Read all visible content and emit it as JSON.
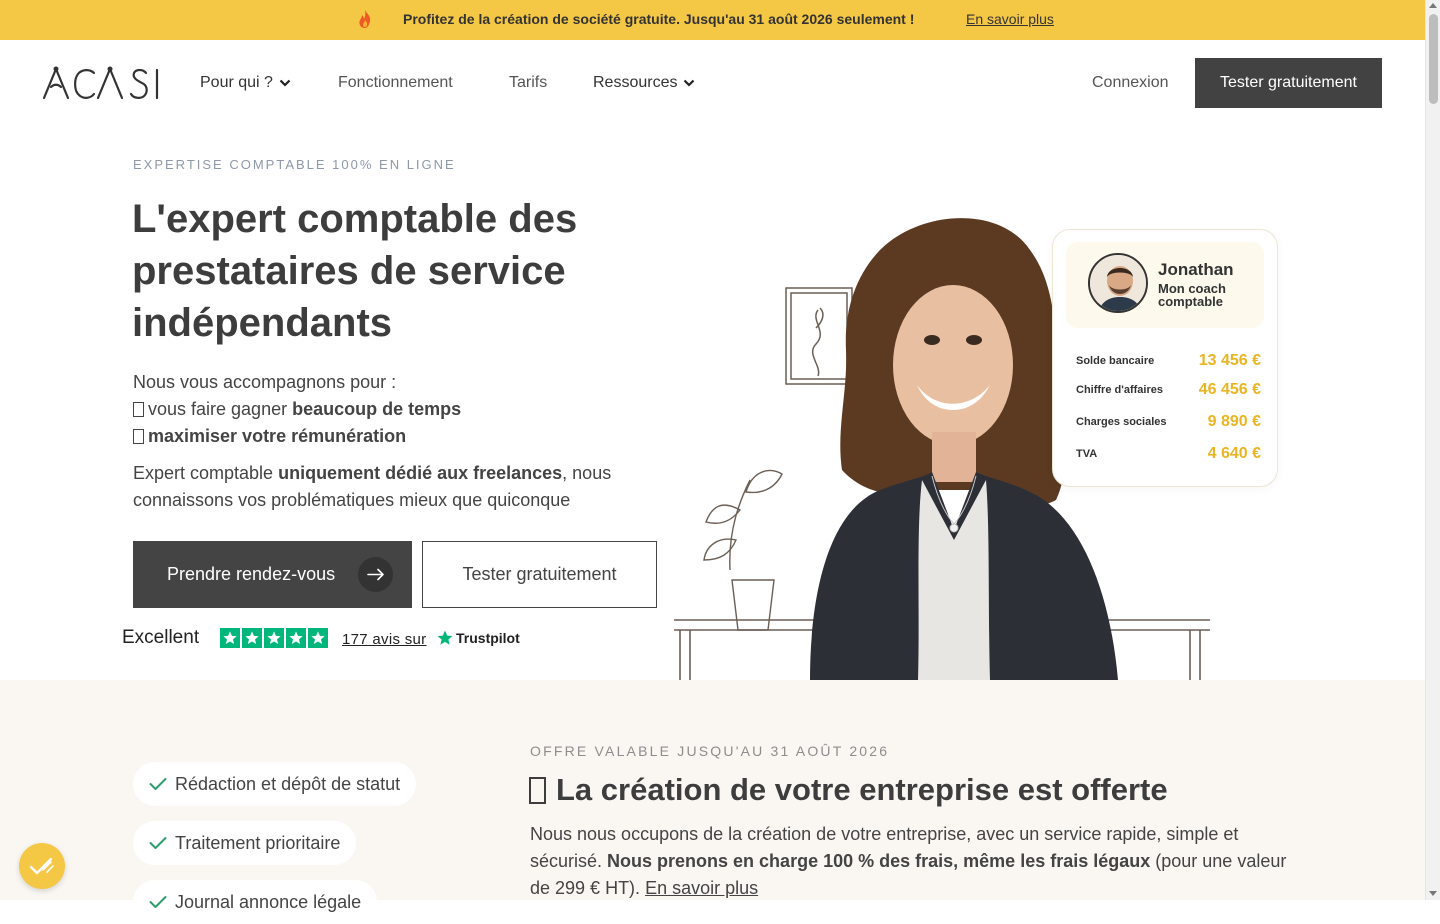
{
  "promo": {
    "message": "Profitez de la création de société gratuite. Jusqu'au 31 août 2026 seulement !",
    "link": "En savoir plus",
    "icon": "fire-icon"
  },
  "header": {
    "logo": "ACASI",
    "nav": [
      {
        "label": "Pour qui ?",
        "has_dropdown": true
      },
      {
        "label": "Fonctionnement",
        "has_dropdown": false
      },
      {
        "label": "Tarifs",
        "has_dropdown": false
      },
      {
        "label": "Ressources",
        "has_dropdown": true
      }
    ],
    "login": "Connexion",
    "cta": "Tester gratuitement"
  },
  "hero": {
    "eyebrow": "EXPERTISE COMPTABLE 100% EN LIGNE",
    "title": "L'expert comptable des prestataires de service indépendants",
    "intro": "Nous vous accompagnons pour :",
    "bullet1_pre": "vous faire gagner ",
    "bullet1_bold": "beaucoup de temps",
    "bullet2_bold": "maximiser votre rémunération",
    "para_pre": "Expert comptable ",
    "para_bold": "uniquement dédié aux freelances",
    "para_post": ", nous connaissons vos problématiques mieux que quiconque",
    "btn_primary": "Prendre rendez-vous",
    "btn_secondary": "Tester gratuitement"
  },
  "trustpilot": {
    "rating_word": "Excellent",
    "stars": 5,
    "reviews": "177 avis sur",
    "brand": "Trustpilot"
  },
  "coach_card": {
    "name": "Jonathan",
    "role": "Mon coach comptable",
    "metrics": [
      {
        "label": "Solde bancaire",
        "value": "13 456 €"
      },
      {
        "label": "Chiffre d'affaires",
        "value": "46 456 €"
      },
      {
        "label": "Charges sociales",
        "value": "9 890 €"
      },
      {
        "label": "TVA",
        "value": "4 640 €"
      }
    ]
  },
  "offer": {
    "features": [
      "Rédaction et dépôt de statut",
      "Traitement prioritaire",
      "Journal annonce légale"
    ],
    "eyebrow": "OFFRE VALABLE JUSQU'AU 31 AOÛT 2026",
    "title": "La création de votre entreprise est offerte",
    "text_pre": "Nous nous occupons de la création de votre entreprise, avec un service rapide, simple et sécurisé. ",
    "text_bold": "Nous prenons en charge 100 % des frais, même les frais légaux",
    "text_post": " (pour une valeur de 299 € HT). ",
    "text_link": "En savoir plus"
  },
  "colors": {
    "accent_yellow": "#f4c744",
    "dark_button": "#424242",
    "trustpilot_green": "#00b67a",
    "metric_value": "#e9b522",
    "section_bg": "#faf7f2"
  }
}
